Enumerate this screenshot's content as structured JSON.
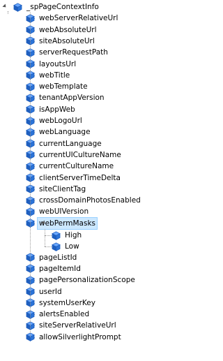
{
  "tree": {
    "root": {
      "label": "_spPageContextInfo",
      "icon": "property-cube-icon"
    },
    "items": [
      {
        "label": "webServerRelativeUrl"
      },
      {
        "label": "webAbsoluteUrl"
      },
      {
        "label": "siteAbsoluteUrl"
      },
      {
        "label": "serverRequestPath"
      },
      {
        "label": "layoutsUrl"
      },
      {
        "label": "webTitle"
      },
      {
        "label": "webTemplate"
      },
      {
        "label": "tenantAppVersion"
      },
      {
        "label": "isAppWeb"
      },
      {
        "label": "webLogoUrl"
      },
      {
        "label": "webLanguage"
      },
      {
        "label": "currentLanguage"
      },
      {
        "label": "currentUICultureName"
      },
      {
        "label": "currentCultureName"
      },
      {
        "label": "clientServerTimeDelta"
      },
      {
        "label": "siteClientTag"
      },
      {
        "label": "crossDomainPhotosEnabled"
      },
      {
        "label": "webUIVersion"
      },
      {
        "label": "webPermMasks",
        "selected": true,
        "children": [
          {
            "label": "High"
          },
          {
            "label": "Low"
          }
        ]
      },
      {
        "label": "pageListId"
      },
      {
        "label": "pageItemId"
      },
      {
        "label": "pagePersonalizationScope"
      },
      {
        "label": "userId"
      },
      {
        "label": "systemUserKey"
      },
      {
        "label": "alertsEnabled"
      },
      {
        "label": "siteServerRelativeUrl"
      },
      {
        "label": "allowSilverlightPrompt"
      }
    ]
  },
  "colors": {
    "selection_fill": "#cce8ff",
    "selection_border": "#99d1ff",
    "icon_blue": "#1f5fbf",
    "icon_light": "#6aa8ff",
    "tree_line": "#9a9a9a"
  }
}
